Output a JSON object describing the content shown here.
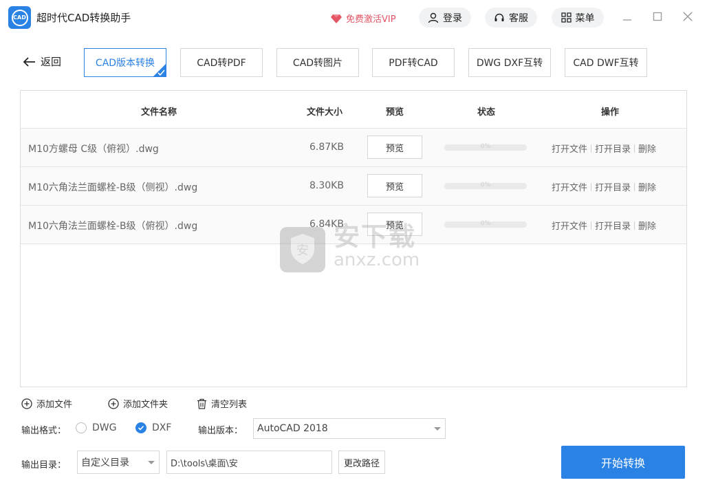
{
  "app": {
    "title": "超时代CAD转换助手",
    "logo_text": "CAD"
  },
  "header": {
    "vip_label": "免费激活VIP",
    "login_label": "登录",
    "service_label": "客服",
    "menu_label": "菜单"
  },
  "toolbar": {
    "back_label": "返回",
    "tabs": [
      {
        "label": "CAD版本转换",
        "active": true
      },
      {
        "label": "CAD转PDF",
        "active": false
      },
      {
        "label": "CAD转图片",
        "active": false
      },
      {
        "label": "PDF转CAD",
        "active": false
      },
      {
        "label": "DWG DXF互转",
        "active": false
      },
      {
        "label": "CAD DWF互转",
        "active": false
      }
    ]
  },
  "table": {
    "columns": {
      "name": "文件名称",
      "size": "文件大小",
      "preview": "预览",
      "status": "状态",
      "actions": "操作"
    },
    "rows": [
      {
        "name": "M10方螺母 C级（俯视）.dwg",
        "size": "6.87KB",
        "preview": "预览",
        "progress": "0%",
        "progress_value": 0,
        "open_file": "打开文件",
        "open_dir": "打开目录",
        "delete": "删除"
      },
      {
        "name": "M10六角法兰面螺栓-B级（侧视）.dwg",
        "size": "8.30KB",
        "preview": "预览",
        "progress": "0%",
        "progress_value": 0,
        "open_file": "打开文件",
        "open_dir": "打开目录",
        "delete": "删除"
      },
      {
        "name": "M10六角法兰面螺栓-B级（俯视）.dwg",
        "size": "6.84KB",
        "preview": "预览",
        "progress": "0%",
        "progress_value": 0,
        "open_file": "打开文件",
        "open_dir": "打开目录",
        "delete": "删除"
      }
    ]
  },
  "watermark": {
    "cn": "安下载",
    "en": "anxz.com",
    "badge": "安"
  },
  "file_actions": {
    "add_file": "添加文件",
    "add_folder": "添加文件夹",
    "clear_list": "清空列表"
  },
  "output": {
    "format_label": "输出格式：",
    "format_options": [
      {
        "label": "DWG",
        "checked": false
      },
      {
        "label": "DXF",
        "checked": true
      }
    ],
    "version_label": "输出版本：",
    "version_value": "AutoCAD 2018",
    "dir_label": "输出目录：",
    "dir_mode": "自定义目录",
    "dir_path": "D:\\tools\\桌面\\安",
    "change_path_label": "更改路径",
    "start_label": "开始转换"
  },
  "colors": {
    "accent": "#2a82e4",
    "vip": "#e45565"
  }
}
